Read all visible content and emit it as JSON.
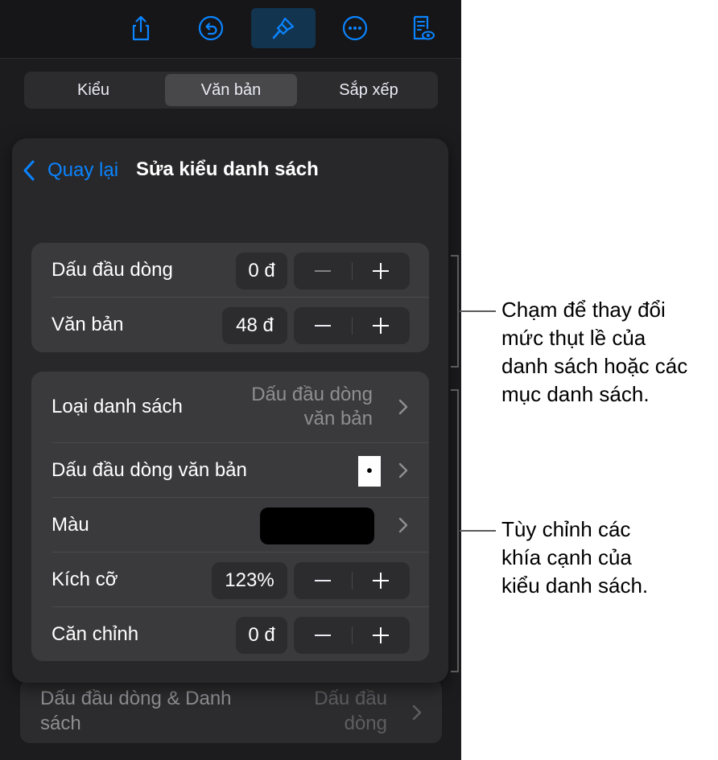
{
  "toolbar": {
    "buttons": [
      {
        "name": "share-icon"
      },
      {
        "name": "undo-icon"
      },
      {
        "name": "format-brush-icon",
        "active": true
      },
      {
        "name": "more-icon"
      },
      {
        "name": "reading-view-icon"
      }
    ],
    "accent_color": "#0a84ff"
  },
  "tabs": [
    {
      "label": "Kiểu"
    },
    {
      "label": "Văn bản",
      "selected": true
    },
    {
      "label": "Sắp xếp"
    }
  ],
  "sheet": {
    "back_label": "Quay lại",
    "title": "Sửa kiểu danh sách",
    "indent_group": {
      "rows": [
        {
          "label": "Dấu đầu dòng",
          "value": "0 đ"
        },
        {
          "label": "Văn bản",
          "value": "48 đ"
        }
      ]
    },
    "style_group": {
      "list_type": {
        "label": "Loại danh sách",
        "value_line1": "Dấu đầu dòng",
        "value_line2": "văn bản"
      },
      "bullet": {
        "label": "Dấu đầu dòng văn bản",
        "glyph": "•"
      },
      "color": {
        "label": "Màu",
        "swatch": "#000000"
      },
      "size": {
        "label": "Kích cỡ",
        "value": "123%"
      },
      "align": {
        "label": "Căn chỉnh",
        "value": "0 đ"
      }
    }
  },
  "behind_row": {
    "label_line1": "Dấu đầu dòng & Danh",
    "label_line2": "sách",
    "value_line1": "Dấu đầu",
    "value_line2": "dòng"
  },
  "callouts": {
    "top": [
      "Chạm để thay đổi",
      "mức thụt lề của",
      "danh sách hoặc các",
      "mục danh sách."
    ],
    "bottom": [
      "Tùy chỉnh các",
      "khía cạnh của",
      "kiểu danh sách."
    ]
  }
}
